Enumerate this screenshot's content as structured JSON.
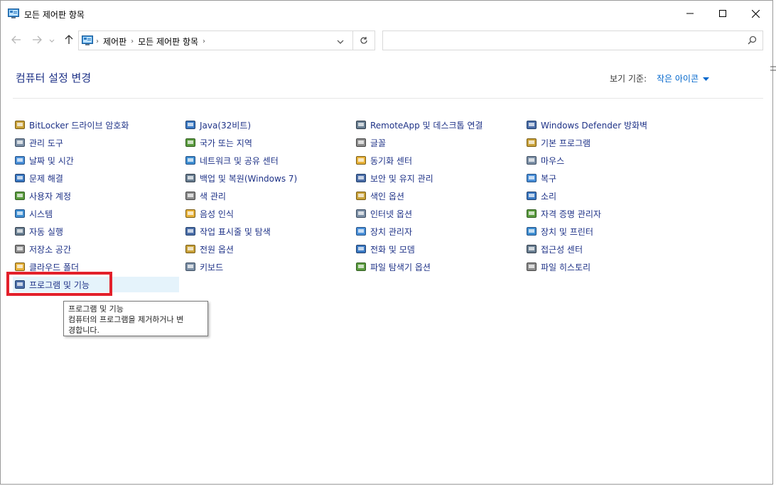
{
  "window": {
    "title": "모든 제어판 항목",
    "controls": {
      "minimize": "minimize-icon",
      "maximize": "maximize-icon",
      "close": "close-icon"
    }
  },
  "nav": {
    "breadcrumb": [
      "제어판",
      "모든 제어판 항목"
    ]
  },
  "search": {
    "placeholder": ""
  },
  "header": {
    "title": "컴퓨터 설정 변경",
    "view_label": "보기 기준:",
    "view_value": "작은 아이콘"
  },
  "columns": [
    [
      "BitLocker 드라이브 암호화",
      "관리 도구",
      "날짜 및 시간",
      "문제 해결",
      "사용자 계정",
      "시스템",
      "자동 실행",
      "저장소 공간",
      "클라우드 폴더",
      "프로그램 및 기능"
    ],
    [
      "Java(32비트)",
      "국가 또는 지역",
      "네트워크 및 공유 센터",
      "백업 및 복원(Windows 7)",
      "색 관리",
      "음성 인식",
      "작업 표시줄 및 탐색",
      "전원 옵션",
      "키보드"
    ],
    [
      "RemoteApp 및 데스크톱 연결",
      "글꼴",
      "동기화 센터",
      "보안 및 유지 관리",
      "색인 옵션",
      "인터넷 옵션",
      "장치 관리자",
      "전화 및 모뎀",
      "파일 탐색기 옵션"
    ],
    [
      "Windows Defender 방화벽",
      "기본 프로그램",
      "마우스",
      "복구",
      "소리",
      "자격 증명 관리자",
      "장치 및 프린터",
      "접근성 센터",
      "파일 히스토리"
    ]
  ],
  "tooltip": {
    "title": "프로그램 및 기능",
    "line1": "컴퓨터의 프로그램을 제거하거나 변",
    "line2": "경합니다."
  },
  "colors": {
    "link": "#1e3287",
    "accent": "#0066cc",
    "highlight": "#e3202b",
    "hover": "#e5f3fb"
  }
}
